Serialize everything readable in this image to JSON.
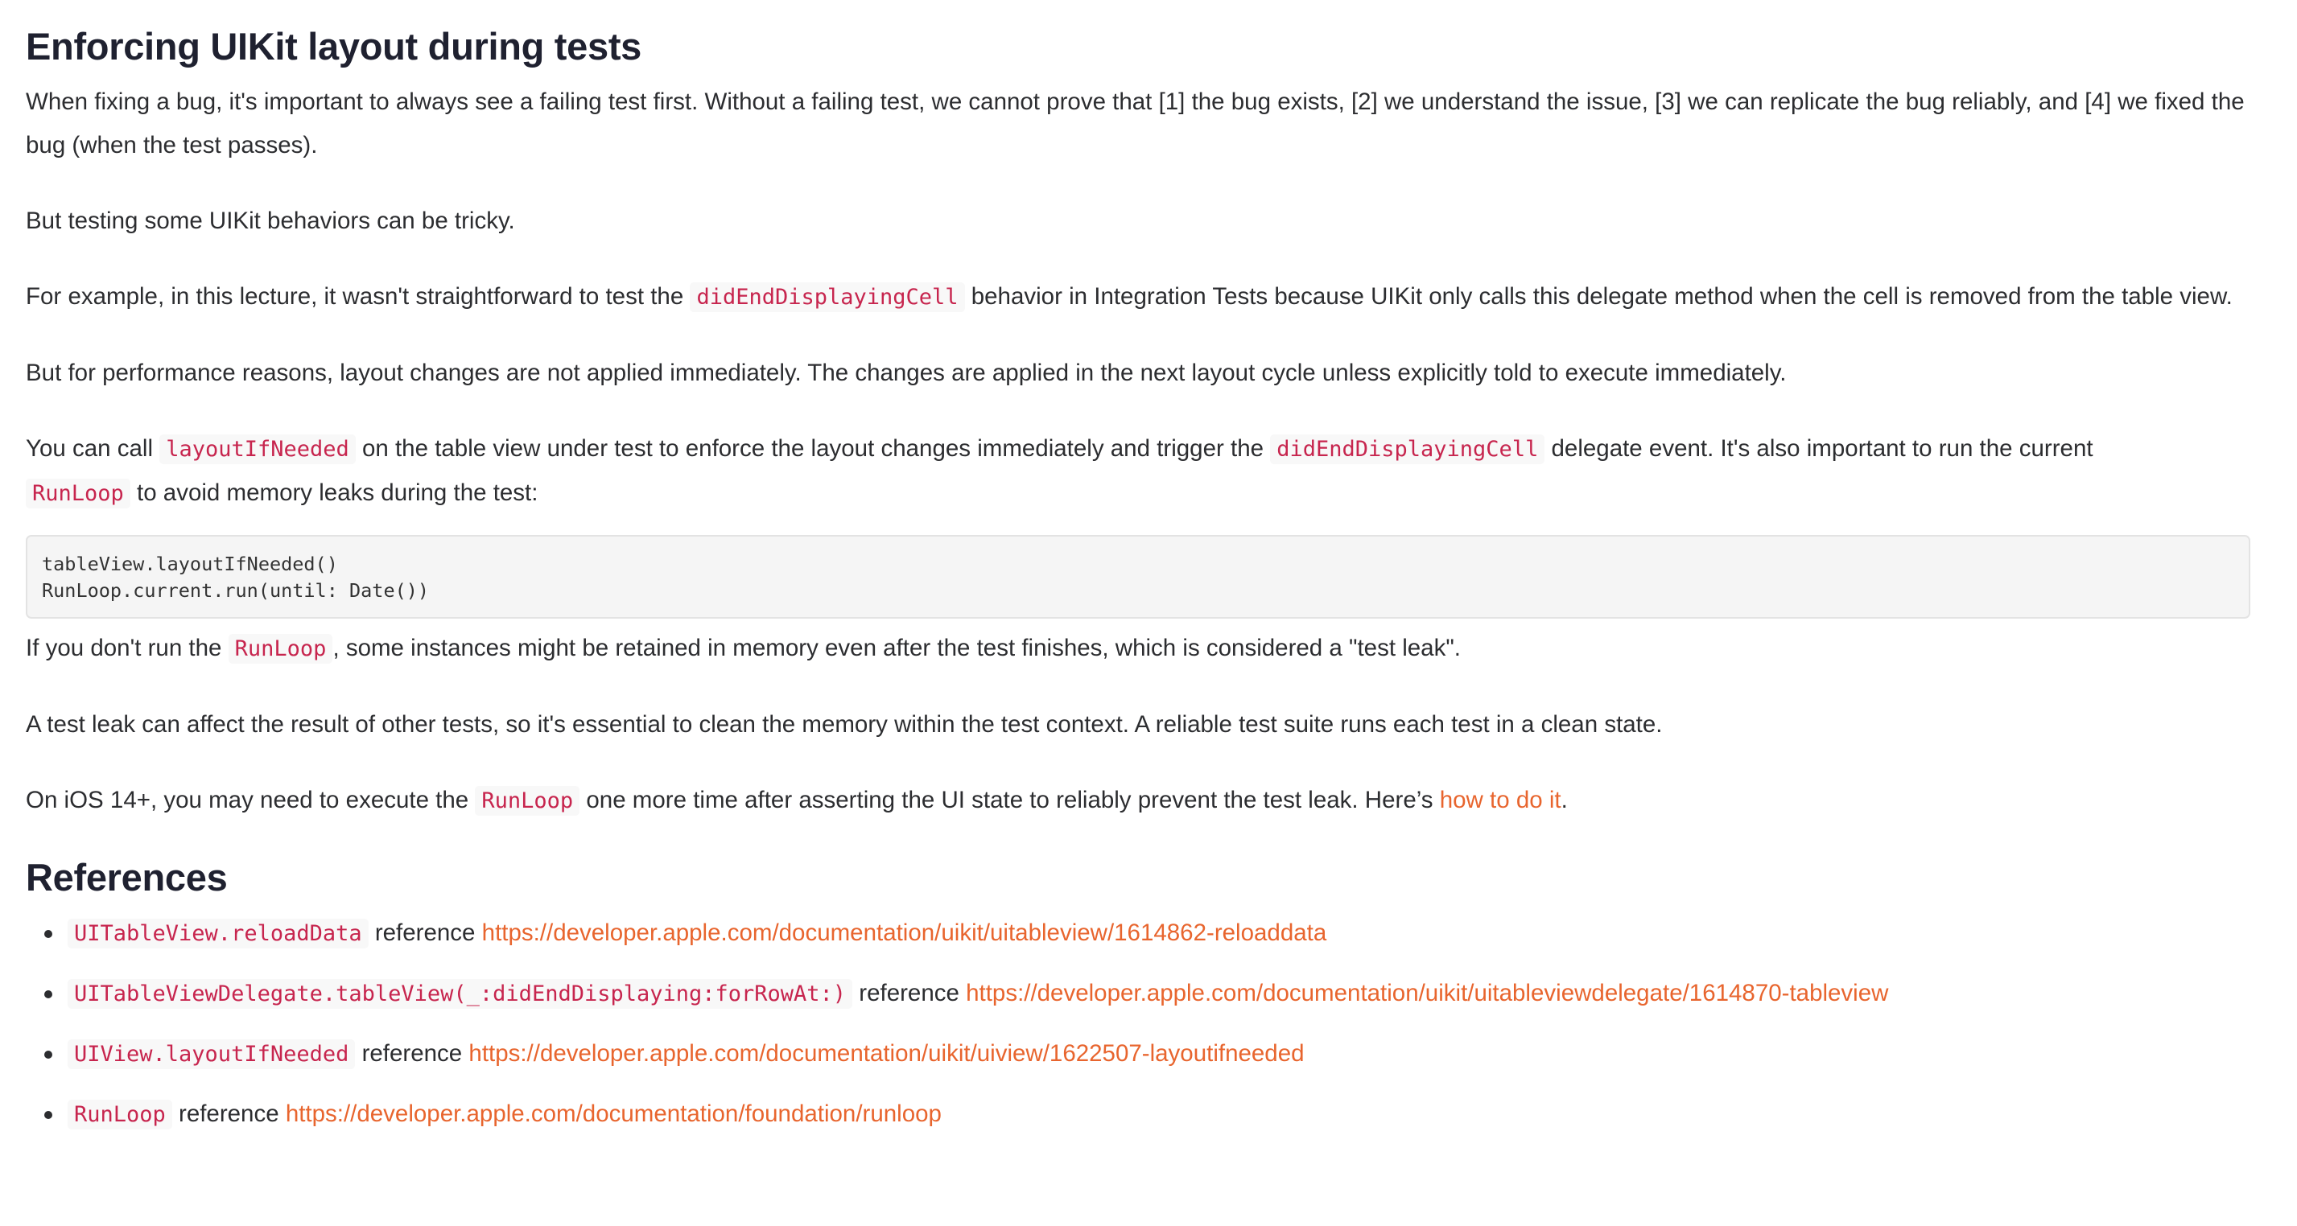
{
  "title": "Enforcing UIKit layout during tests",
  "p1": "When fixing a bug, it's important to always see a failing test first. Without a failing test, we cannot prove that [1] the bug exists, [2] we understand the issue, [3] we can replicate the bug reliably, and [4] we fixed the bug (when the test passes).",
  "p2": "But testing some UIKit behaviors can be tricky.",
  "p3": {
    "before": "For example, in this lecture, it wasn't straightforward to test the ",
    "code": "didEndDisplayingCell",
    "after": " behavior in Integration Tests because UIKit only calls this delegate method when the cell is removed from the table view."
  },
  "p4": "But for performance reasons, layout changes are not applied immediately. The changes are applied in the next layout cycle unless explicitly told to execute immediately.",
  "p5": {
    "t1": "You can call ",
    "c1": "layoutIfNeeded",
    "t2": " on the table view under test to enforce the layout changes immediately and trigger the ",
    "c2": "didEndDisplayingCell",
    "t3": " delegate event. It's also important to run the current ",
    "c3": "RunLoop",
    "t4": " to avoid memory leaks during the test:"
  },
  "code_block": "tableView.layoutIfNeeded()\nRunLoop.current.run(until: Date())",
  "p6": {
    "t1": "If you don't run the ",
    "c1": "RunLoop",
    "t2": ", some instances might be retained in memory even after the test finishes, which is considered a \"test leak\"."
  },
  "p7": "A test leak can affect the result of other tests, so it's essential to clean the memory within the test context. A reliable test suite runs each test in a clean state.",
  "p8": {
    "t1": "On iOS 14+, you may need to execute the ",
    "c1": "RunLoop",
    "t2": " one more time after asserting the UI state to reliably prevent the test leak. Here’s ",
    "link": "how to do it",
    "t3": "."
  },
  "references_heading": "References",
  "references": [
    {
      "code": "UITableView.reloadData",
      "label": " reference ",
      "url": "https://developer.apple.com/documentation/uikit/uitableview/1614862-reloaddata"
    },
    {
      "code": "UITableViewDelegate.tableView(_:didEndDisplaying:forRowAt:)",
      "label": " reference ",
      "url": "https://developer.apple.com/documentation/uikit/uitableviewdelegate/1614870-tableview"
    },
    {
      "code": "UIView.layoutIfNeeded",
      "label": " reference ",
      "url": "https://developer.apple.com/documentation/uikit/uiview/1622507-layoutifneeded"
    },
    {
      "code": "RunLoop",
      "label": " reference ",
      "url": "https://developer.apple.com/documentation/foundation/runloop"
    }
  ],
  "colors": {
    "text": "#2c2d30",
    "heading": "#1f2130",
    "link": "#e8652e",
    "inline_code": "#c7254e",
    "code_block_bg": "#f5f5f5"
  }
}
